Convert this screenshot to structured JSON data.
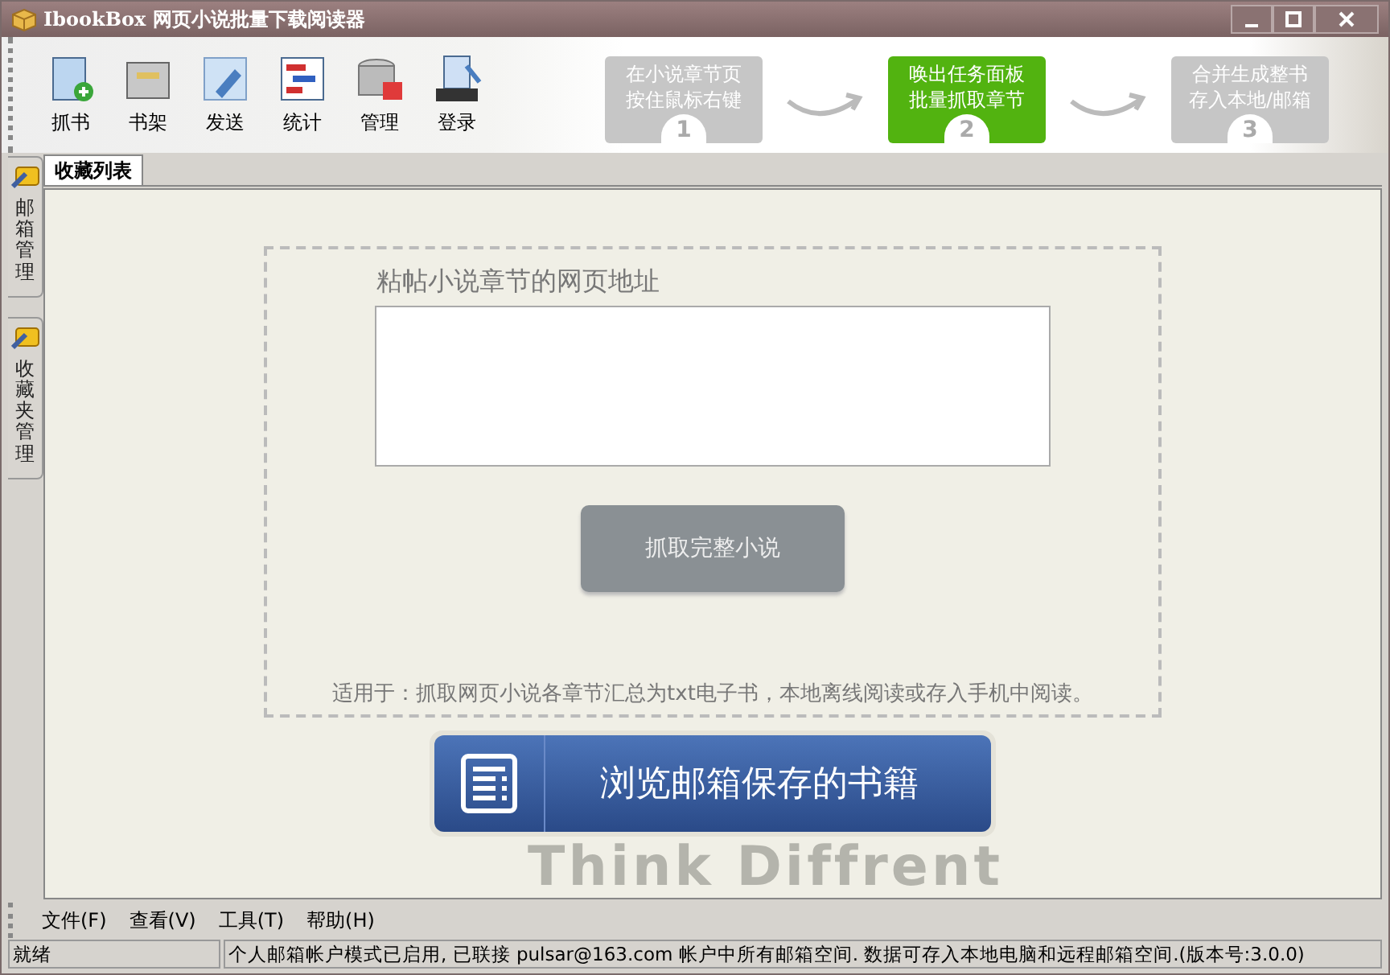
{
  "window": {
    "title": "IbookBox  网页小说批量下载阅读器"
  },
  "toolbar": [
    {
      "label": "抓书",
      "kind": "notebook"
    },
    {
      "label": "书架",
      "kind": "cabinet"
    },
    {
      "label": "发送",
      "kind": "tag"
    },
    {
      "label": "统计",
      "kind": "chart"
    },
    {
      "label": "管理",
      "kind": "database"
    },
    {
      "label": "登录",
      "kind": "mail"
    }
  ],
  "steps": [
    {
      "lines": [
        "在小说章节页",
        "按住鼠标右键"
      ],
      "number": "1",
      "selected": false
    },
    {
      "lines": [
        "唤出任务面板",
        "批量抓取章节"
      ],
      "number": "2",
      "selected": true
    },
    {
      "lines": [
        "合并生成整书",
        "存入本地/邮箱"
      ],
      "number": "3",
      "selected": false
    }
  ],
  "side_tabs": [
    {
      "label": "邮箱管理",
      "selected": false
    },
    {
      "label": "收藏夹管理",
      "selected": false
    }
  ],
  "tabs": [
    {
      "label": "收藏列表",
      "selected": true
    }
  ],
  "panel": {
    "heading": "粘帖小说章节的网页地址",
    "grab_button": "抓取完整小说",
    "note": "适用于：抓取网页小说各章节汇总为txt电子书，本地离线阅读或存入手机中阅读。"
  },
  "browse_button": "浏览邮箱保存的书籍",
  "slogan": "Think Diffrent",
  "menu": [
    "文件(F)",
    "查看(V)",
    "工具(T)",
    "帮助(H)"
  ],
  "status_bar": [
    "就绪",
    "个人邮箱帐户模式已启用, 已联接 pulsar@163.com 帐户中所有邮箱空间. 数据可存入本地电脑和远程邮箱空间.(版本号:3.0.0)"
  ]
}
